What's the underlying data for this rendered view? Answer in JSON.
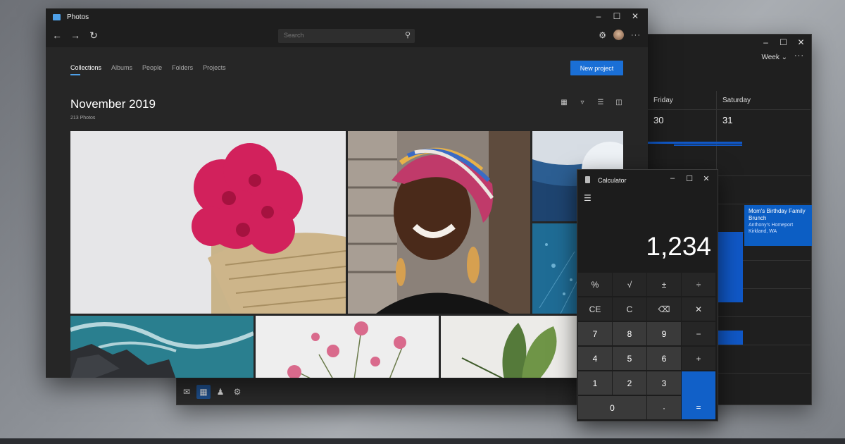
{
  "calendar": {
    "view_label": "Week",
    "more": "···",
    "days": [
      {
        "name": "Friday",
        "num": "30"
      },
      {
        "name": "Saturday",
        "num": "31"
      }
    ],
    "event": {
      "title": "Mom's Birthday Family Brunch",
      "location": "Anthony's Homeport",
      "city": "Kirkland, WA"
    },
    "window_controls": [
      "–",
      "☐",
      "✕"
    ],
    "taskbar_icons": [
      "mail-icon",
      "calendar-icon",
      "people-icon",
      "gear-icon"
    ]
  },
  "photos": {
    "app_title": "Photos",
    "window_controls": [
      "–",
      "☐",
      "✕"
    ],
    "search_placeholder": "Search",
    "tabs": [
      "Collections",
      "Albums",
      "People",
      "Folders",
      "Projects"
    ],
    "active_tab": "Collections",
    "new_project_label": "New project",
    "heading": "November 2019",
    "photo_count": "213 Photos",
    "view_icons": [
      "grid-icon",
      "filter-icon",
      "list-icon",
      "slideshow-icon"
    ]
  },
  "calculator": {
    "title": "Calculator",
    "window_controls": [
      "–",
      "☐",
      "✕"
    ],
    "display": "1,234",
    "keys": [
      [
        "%",
        "√",
        "±",
        "÷"
      ],
      [
        "CE",
        "C",
        "⌫",
        "✕"
      ],
      [
        "7",
        "8",
        "9",
        "−"
      ],
      [
        "4",
        "5",
        "6",
        "+"
      ],
      [
        "1",
        "2",
        "3",
        ""
      ],
      [
        "0",
        "·",
        "="
      ]
    ]
  },
  "colors": {
    "accent": "#1a6fd6",
    "window_bg": "#1e1e1e",
    "event_blue": "#0c5ec4"
  }
}
